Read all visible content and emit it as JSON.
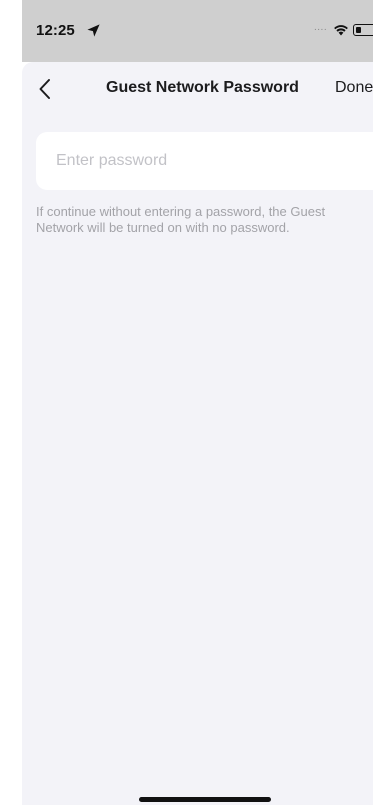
{
  "status_bar": {
    "time": "12:25",
    "signal_indicator": "....",
    "location_icon": "location-arrow-icon",
    "wifi_icon": "wifi-icon",
    "battery_icon": "battery-icon",
    "battery_level": 0.3
  },
  "nav": {
    "back_icon": "chevron-left-icon",
    "title": "Guest Network Password",
    "done_label": "Done"
  },
  "password_field": {
    "value": "",
    "placeholder": "Enter password"
  },
  "hint": "If continue without entering a password, the Guest Network will be turned on with no password.",
  "colors": {
    "status_bar_bg": "#cfcfcf",
    "sheet_bg": "#f3f3f8",
    "card_bg": "#ffffff",
    "placeholder": "#c2c2c7",
    "hint_text": "#a3a3a8",
    "title_text": "#1c1c1e"
  }
}
